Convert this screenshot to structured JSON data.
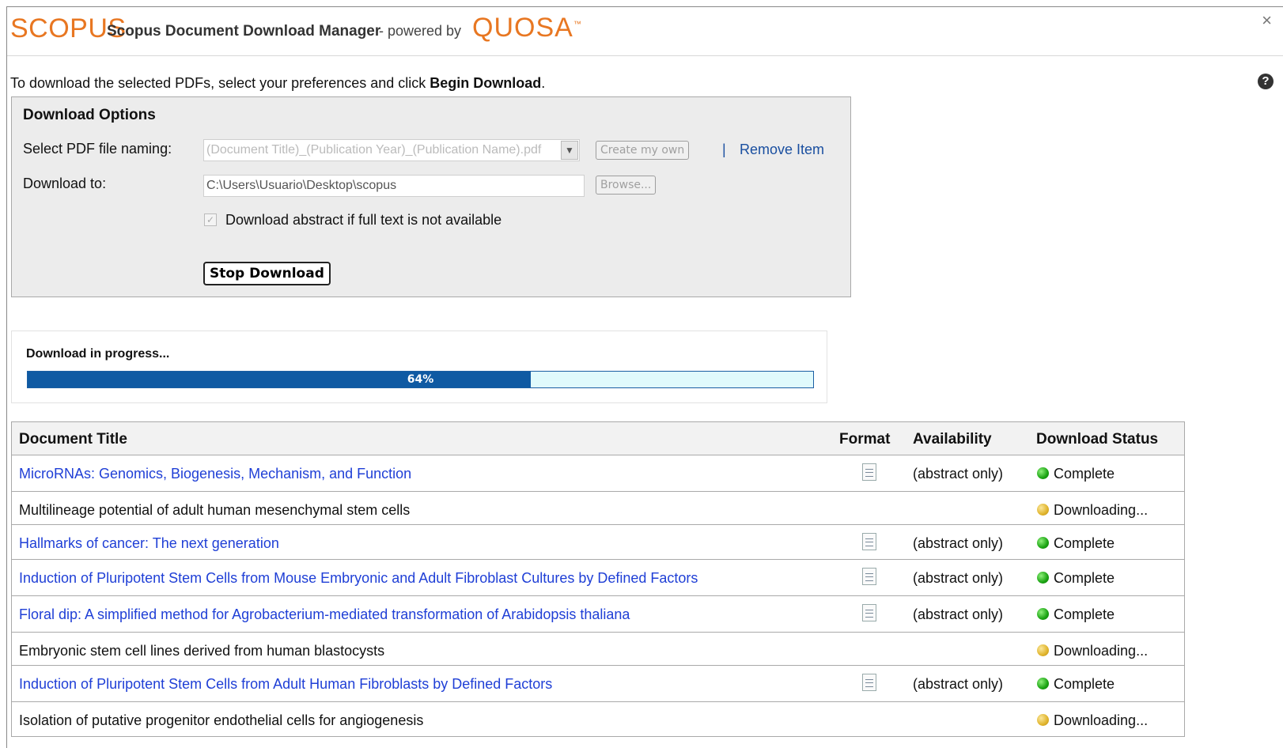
{
  "header": {
    "logo": "SCOPUS",
    "title": "Scopus Document Download Manager",
    "powered_by": "- powered by",
    "quosa_logo": "QUOSA",
    "tm": "™",
    "close": "×",
    "help": "?"
  },
  "instructions": {
    "prefix": "To download the selected PDFs, select your preferences and click ",
    "action": "Begin Download",
    "suffix": "."
  },
  "options": {
    "title": "Download Options",
    "naming_label": "Select PDF file naming:",
    "naming_value": "(Document Title)_(Publication Year)_(Publication Name).pdf",
    "create_btn": "Create my own",
    "separator": "|",
    "remove_link": "Remove Item",
    "download_to_label": "Download to:",
    "download_path": "C:\\Users\\Usuario\\Desktop\\scopus",
    "browse_btn": "Browse...",
    "abstract_checkbox_label": "Download abstract if full text is not available",
    "abstract_checked": true,
    "stop_btn": "Stop Download"
  },
  "progress": {
    "label": "Download in progress...",
    "percent": 64,
    "percent_text": "64%"
  },
  "table": {
    "headers": {
      "title": "Document Title",
      "format": "Format",
      "availability": "Availability",
      "status": "Download Status"
    },
    "rows": [
      {
        "title": "MicroRNAs: Genomics, Biogenesis, Mechanism, and Function",
        "link": true,
        "format": true,
        "availability": "(abstract only)",
        "status": "Complete"
      },
      {
        "title": "Multilineage potential of adult human mesenchymal stem cells",
        "link": false,
        "format": false,
        "availability": "",
        "status": "Downloading..."
      },
      {
        "title": "Hallmarks of cancer: The next generation",
        "link": true,
        "format": true,
        "availability": "(abstract only)",
        "status": "Complete"
      },
      {
        "title": "Induction of Pluripotent Stem Cells from Mouse Embryonic and Adult Fibroblast Cultures by Defined Factors",
        "link": true,
        "format": true,
        "availability": "(abstract only)",
        "status": "Complete"
      },
      {
        "title": "Floral dip: A simplified method for Agrobacterium-mediated transformation of Arabidopsis thaliana",
        "link": true,
        "format": true,
        "availability": "(abstract only)",
        "status": "Complete"
      },
      {
        "title": "Embryonic stem cell lines derived from human blastocysts",
        "link": false,
        "format": false,
        "availability": "",
        "status": "Downloading..."
      },
      {
        "title": "Induction of Pluripotent Stem Cells from Adult Human Fibroblasts by Defined Factors",
        "link": true,
        "format": true,
        "availability": "(abstract only)",
        "status": "Complete"
      },
      {
        "title": "Isolation of putative progenitor endothelial cells for angiogenesis",
        "link": false,
        "format": false,
        "availability": "",
        "status": "Downloading..."
      }
    ]
  },
  "colors": {
    "brand_orange": "#e87722",
    "link_blue": "#1f3fd6",
    "progress_fill": "#0f5aa3",
    "progress_track": "#e0fafc",
    "status_complete": "#1aa312",
    "status_downloading": "#e0b42c"
  }
}
